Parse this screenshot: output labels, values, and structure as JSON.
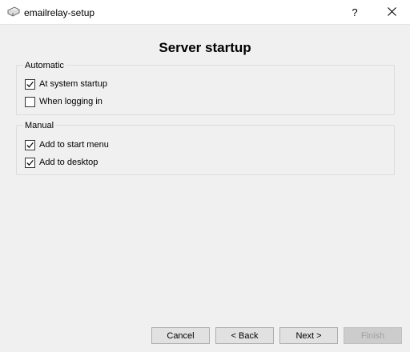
{
  "window": {
    "title": "emailrelay-setup",
    "help_glyph": "?",
    "close_glyph": "✕"
  },
  "page": {
    "heading": "Server startup"
  },
  "groups": {
    "automatic": {
      "legend": "Automatic",
      "items": [
        {
          "label": "At system startup",
          "checked": true
        },
        {
          "label": "When logging in",
          "checked": false
        }
      ]
    },
    "manual": {
      "legend": "Manual",
      "items": [
        {
          "label": "Add to start menu",
          "checked": true
        },
        {
          "label": "Add to desktop",
          "checked": true
        }
      ]
    }
  },
  "buttons": {
    "cancel": "Cancel",
    "back": "< Back",
    "next": "Next >",
    "finish": "Finish",
    "finish_enabled": false
  },
  "colors": {
    "window_bg": "#f0f0f0",
    "titlebar_bg": "#ffffff",
    "button_bg": "#e1e1e1",
    "button_disabled_bg": "#cccccc"
  }
}
